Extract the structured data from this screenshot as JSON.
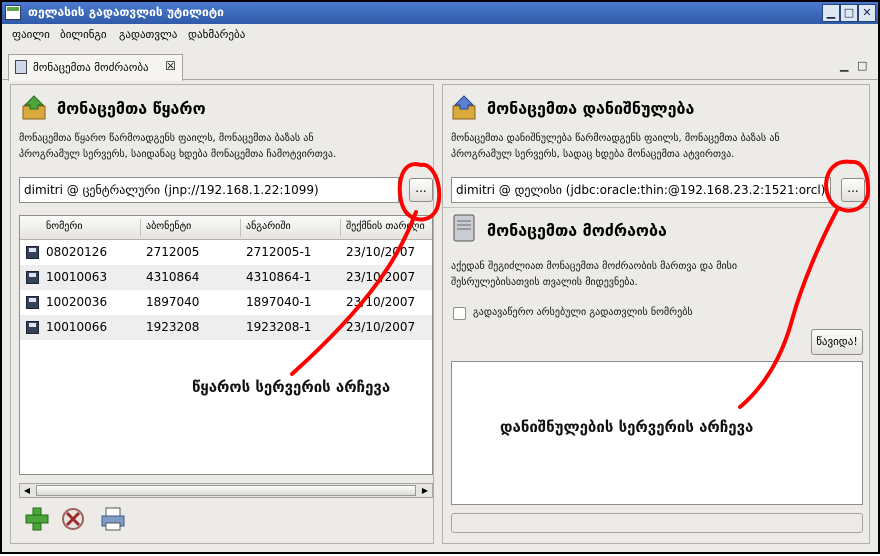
{
  "window": {
    "title": "თელასის გადათვლის უტილიტი"
  },
  "menu": [
    "ფაილი",
    "ბილინგი",
    "გადათვლა",
    "დახმარება"
  ],
  "tab": {
    "label": "მონაცემთა მოძრაობა",
    "close": "☒"
  },
  "source": {
    "title": "მონაცემთა წყარო",
    "description": [
      "მონაცემთა წყარო წარმოადგენს ფაილს, მონაცემთა ბაზას ან",
      "პროგრამულ სერვერს, საიდანაც ხდება მონაცემთა ჩამოტვირთვა."
    ],
    "server": "dimitri @ ცენტრალური (jnp://192.168.1.22:1099)",
    "browse_label": "...",
    "columns": [
      "ნომერი",
      "აბონენტი",
      "ანგარიში",
      "შექმნის თარიღი"
    ],
    "rows": [
      [
        "08020126",
        "2712005",
        "2712005-1",
        "23/10/2007"
      ],
      [
        "10010063",
        "4310864",
        "4310864-1",
        "23/10/2007"
      ],
      [
        "10020036",
        "1897040",
        "1897040-1",
        "23/10/2007"
      ],
      [
        "10010066",
        "1923208",
        "1923208-1",
        "23/10/2007"
      ]
    ]
  },
  "destination": {
    "title": "მონაცემთა დანიშნულება",
    "description": [
      "მონაცემთა დანიშნულება წარმოადგენს ფაილს, მონაცემთა ბაზას ან",
      "პროგრამულ სერვერს, სადაც ხდება მონაცემთა ატვირთვა."
    ],
    "server": "dimitri @ დელისი (jdbc:oracle:thin:@192.168.23.2:1521:orcl)",
    "browse_label": "..."
  },
  "movement": {
    "title": "მონაცემთა მოძრაობა",
    "description": [
      "აქედან შეგიძლიათ მონაცემთა მოძრაობის მართვა და მისი",
      "შესრულებისათვის თვალის მიდევნება."
    ],
    "checkbox_label": "გადავაწერო არსებული გადათვლის ნომრებს",
    "start_label": "წავიდა!"
  },
  "annotations": {
    "source": "წყაროს სერვერის არჩევა",
    "destination": "დანიშნულების სერვერის არჩევა"
  },
  "colors": {
    "title_bar": "#2f5aa8",
    "annotation": "#ff0000"
  }
}
